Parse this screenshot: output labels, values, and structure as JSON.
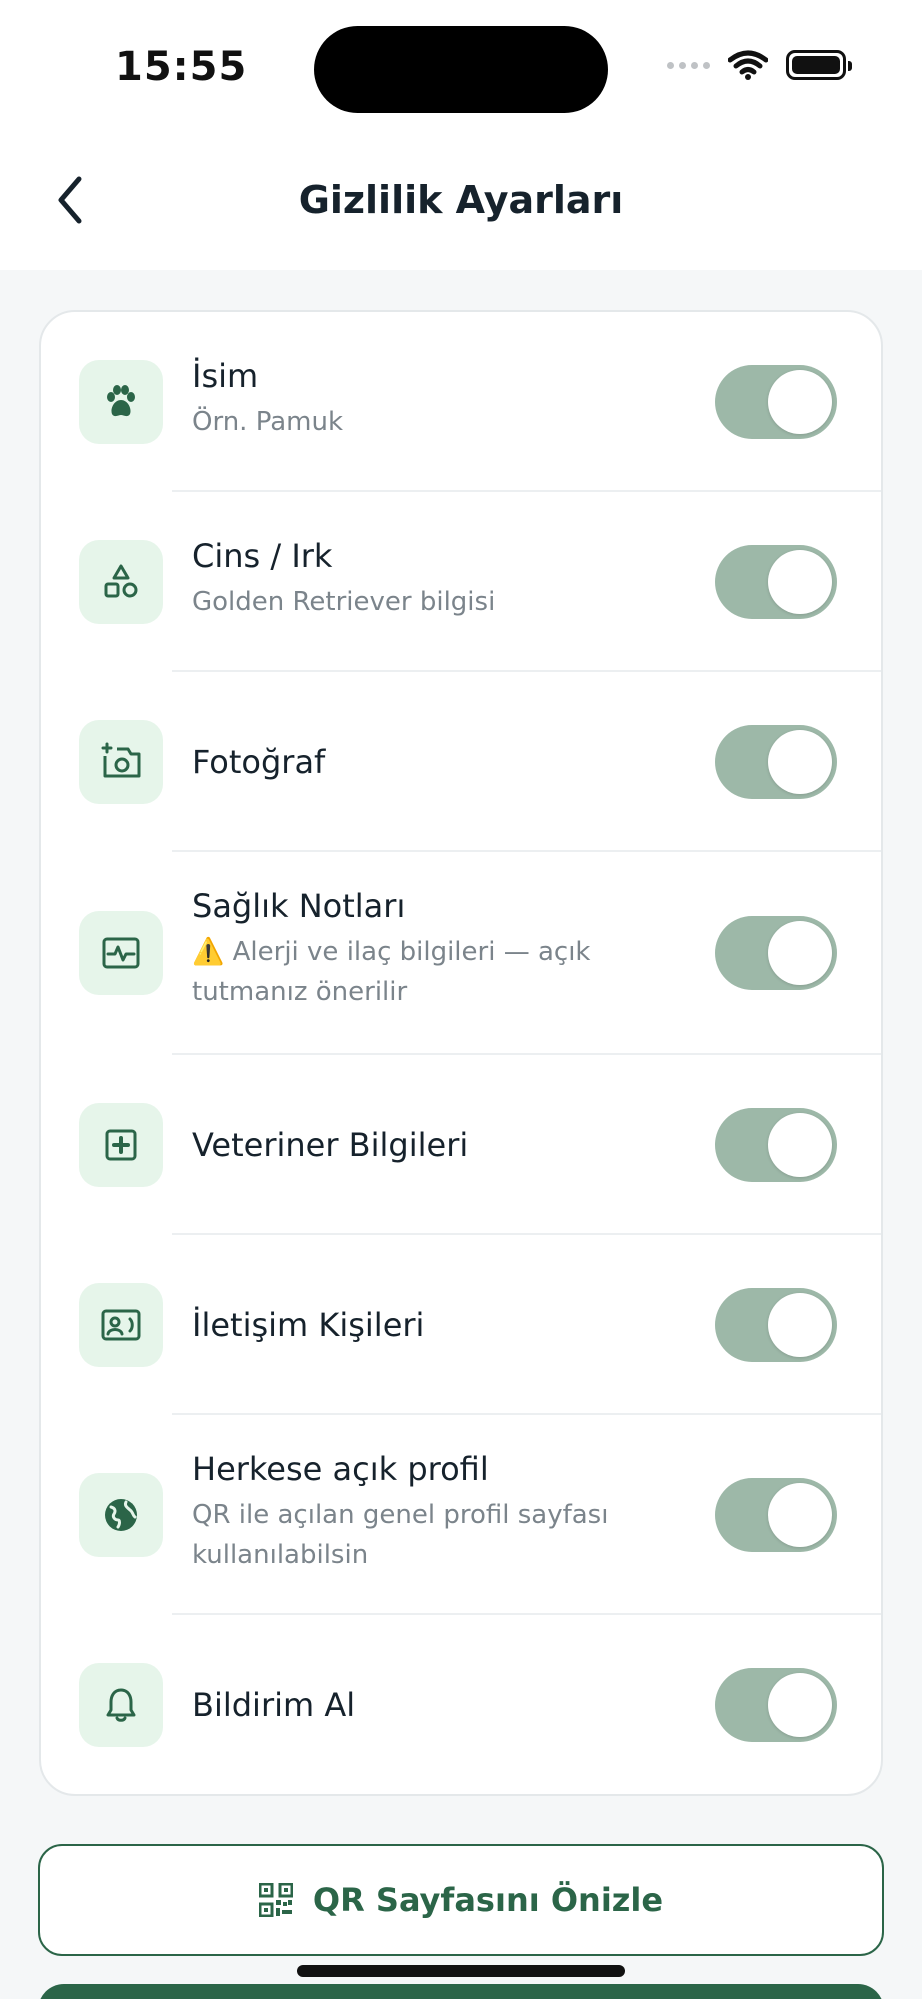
{
  "status_bar": {
    "time": "15:55"
  },
  "header": {
    "title": "Gizlilik Ayarları"
  },
  "settings": [
    {
      "icon": "paw-icon",
      "title": "İsim",
      "subtitle": "Örn. Pamuk",
      "enabled": true
    },
    {
      "icon": "shapes-icon",
      "title": "Cins / Irk",
      "subtitle": "Golden Retriever bilgisi",
      "enabled": true
    },
    {
      "icon": "camera-add-icon",
      "title": "Fotoğraf",
      "subtitle": "",
      "enabled": true
    },
    {
      "icon": "health-monitor-icon",
      "title": "Sağlık Notları",
      "subtitle": "⚠️ Alerji ve ilaç bilgileri — açık tutmanız önerilir",
      "enabled": true
    },
    {
      "icon": "medical-plus-icon",
      "title": "Veteriner Bilgileri",
      "subtitle": "",
      "enabled": true
    },
    {
      "icon": "contact-card-icon",
      "title": "İletişim Kişileri",
      "subtitle": "",
      "enabled": true
    },
    {
      "icon": "globe-icon",
      "title": "Herkese açık profil",
      "subtitle": "QR ile açılan genel profil sayfası kullanılabilsin",
      "enabled": true
    },
    {
      "icon": "bell-icon",
      "title": "Bildirim Al",
      "subtitle": "",
      "enabled": true
    }
  ],
  "actions": {
    "preview_label": "QR Sayfasını Önizle"
  },
  "colors": {
    "accent": "#2b6548",
    "toggle_on": "#9db8a8",
    "icon_bg": "#e6f5ea"
  }
}
